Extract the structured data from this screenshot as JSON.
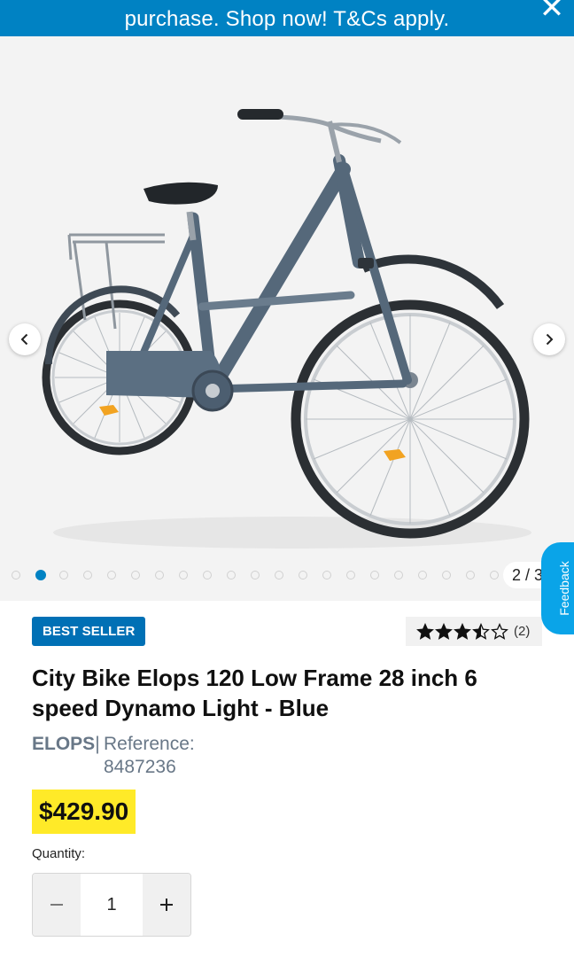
{
  "banner": {
    "text": "purchase. Shop now! T&Cs apply.",
    "close_icon": "close-icon"
  },
  "gallery": {
    "counter": "2 / 3",
    "dot_count": 21,
    "active_dot": 2,
    "prev_icon": "chevron-left-icon",
    "next_icon": "chevron-right-icon",
    "image": "city-bike-image"
  },
  "feedback": {
    "label": "Feedback"
  },
  "product": {
    "badge": "BEST SELLER",
    "rating": {
      "value": 3.5,
      "max": 5,
      "count": "(2)"
    },
    "title": "City Bike Elops 120 Low Frame 28 inch 6 speed Dynamo Light - Blue",
    "brand": "ELOPS",
    "reference_separator": "|",
    "reference": "Reference: 8487236",
    "price": "$429.90"
  },
  "quantity": {
    "label": "Quantity:",
    "value": "1",
    "decrement_icon": "minus-icon",
    "increment_icon": "plus-icon"
  },
  "colors": {
    "accent": "#0082c3",
    "badge": "#0070b5",
    "price_highlight": "#ffea28",
    "feedback": "#0aa4e8",
    "bike_frame": "#55687a"
  }
}
